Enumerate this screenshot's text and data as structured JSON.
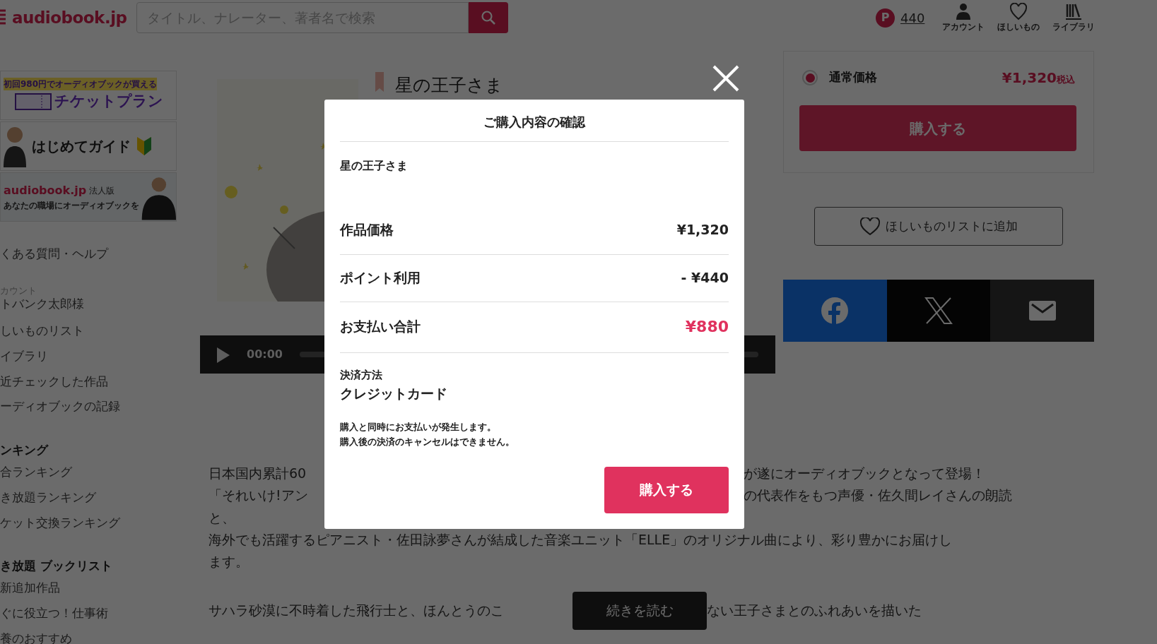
{
  "header": {
    "logo": "audiobook.jp",
    "search": {
      "placeholder": "タイトル、ナレーター、著者名で検索"
    },
    "points": {
      "badge": "P",
      "value": "440"
    },
    "nav": [
      {
        "label": "アカウント"
      },
      {
        "label": "ほしいもの"
      },
      {
        "label": "ライブラリ"
      }
    ]
  },
  "sidebar": {
    "banners": [
      {
        "kind": "ticket",
        "tagline": "初回980円でオーディオブックが買える",
        "title": "チケットプラン"
      },
      {
        "kind": "guide",
        "title": "はじめてガイド"
      },
      {
        "kind": "business",
        "title": "audiobook.jp",
        "tag": "法人版",
        "subtitle": "あなたの職場にオーディオブックを"
      }
    ],
    "entries": [
      {
        "kind": "link",
        "text": "くある質問・ヘルプ"
      },
      {
        "kind": "caption",
        "text": "カウント"
      },
      {
        "kind": "account",
        "text": "トバンク太郎様"
      },
      {
        "kind": "link",
        "text": "しいものリスト"
      },
      {
        "kind": "link",
        "text": "イブラリ"
      },
      {
        "kind": "link",
        "text": "近チェックした作品"
      },
      {
        "kind": "link",
        "text": "ーディオブックの記録"
      },
      {
        "kind": "heading",
        "text": "ンキング"
      },
      {
        "kind": "link",
        "text": "合ランキング"
      },
      {
        "kind": "link",
        "text": "き放題ランキング"
      },
      {
        "kind": "link",
        "text": "ケット交換ランキング"
      },
      {
        "kind": "heading",
        "text": "き放題 ブックリスト"
      },
      {
        "kind": "link",
        "text": "新追加作品"
      },
      {
        "kind": "link",
        "text": "ぐに役立つ！仕事術"
      },
      {
        "kind": "link",
        "text": "養のおすすめ"
      }
    ]
  },
  "product": {
    "title": "星の王子さま",
    "player": {
      "time": "00:00"
    },
    "description": [
      {
        "left": "日本国内累計60",
        "right": "が遂にオーディオブックとなって登場！"
      },
      {
        "left": "「それいけ!アン",
        "right": "の代表作をもつ声優・佐久間レイさんの朗読"
      },
      {
        "left": "と、"
      },
      {
        "left": "海外でも活躍するピアニスト・佐田詠夢さんが結成した音楽ユニット「ELLE」のオリジナル曲により、彩り豊かにお届けし"
      },
      {
        "left": "ます。"
      }
    ],
    "faded": {
      "left": "サハラ砂漠に不時着した飛行士と、ほんとうのこ",
      "right": "ない王子さまとのふれあいを描いた"
    },
    "read_more": "続きを読む"
  },
  "purchase": {
    "option": {
      "label": "通常価格",
      "price": "¥1,320",
      "tax": "税込",
      "selected": true
    },
    "buy": "購入する",
    "wishlist": "ほしいものリストに追加",
    "share": [
      {
        "kind": "facebook"
      },
      {
        "kind": "x"
      },
      {
        "kind": "mail"
      }
    ]
  },
  "modal": {
    "title": "ご購入内容の確認",
    "product": "星の王子さま",
    "rows": [
      {
        "kind": "line",
        "label": "作品価格",
        "value": "¥1,320"
      },
      {
        "kind": "line",
        "label": "ポイント利用",
        "value": "- ¥440"
      },
      {
        "kind": "total",
        "label": "お支払い合計",
        "value": "¥880"
      }
    ],
    "payment_label": "決済方法",
    "payment_method": "クレジットカード",
    "notes": [
      "購入と同時にお支払いが発生します。",
      "購入後の決済のキャンセルはできません。"
    ],
    "button": "購入する"
  }
}
